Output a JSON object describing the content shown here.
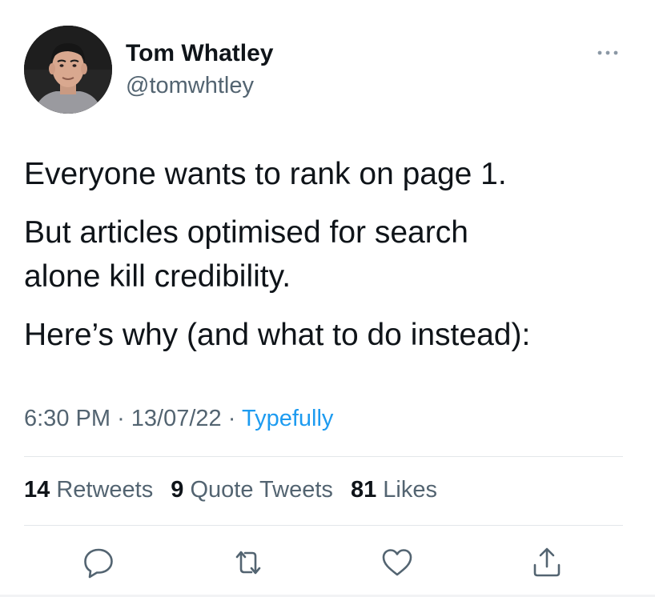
{
  "author": {
    "display_name": "Tom Whatley",
    "handle": "@tomwhtley"
  },
  "tweet": {
    "paragraphs": [
      "Everyone wants to rank on page 1.",
      "But articles optimised for search alone kill credibility.",
      "Here’s why (and what to do instead):"
    ]
  },
  "meta": {
    "time": "6:30 PM",
    "separator": "·",
    "date": "13/07/22",
    "source": "Typefully"
  },
  "stats": {
    "retweets": {
      "count": "14",
      "label": "Retweets"
    },
    "quote_tweets": {
      "count": "9",
      "label": "Quote Tweets"
    },
    "likes": {
      "count": "81",
      "label": "Likes"
    }
  },
  "icons": {
    "more": "more-horizontal-icon",
    "reply": "reply-icon",
    "retweet": "retweet-icon",
    "like": "heart-icon",
    "share": "share-icon"
  },
  "colors": {
    "text": "#0f1419",
    "secondary": "#536471",
    "accent": "#1d9bf0",
    "divider": "#e3e7ea"
  }
}
